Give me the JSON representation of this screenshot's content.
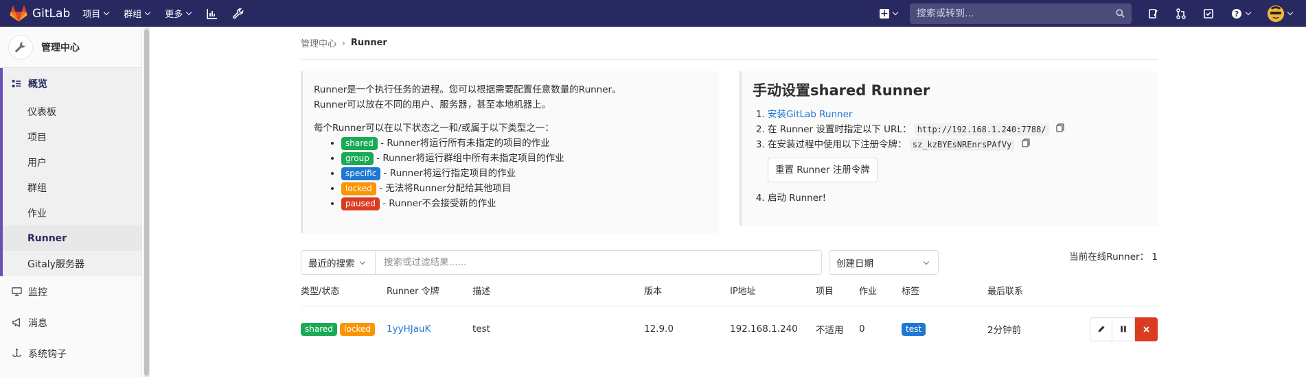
{
  "navbar": {
    "brand": "GitLab",
    "menus": [
      {
        "label": "项目"
      },
      {
        "label": "群组"
      },
      {
        "label": "更多"
      }
    ],
    "search_placeholder": "搜索或转到..."
  },
  "sidebar": {
    "title": "管理中心",
    "overview_label": "概览",
    "sub_items": [
      {
        "label": "仪表板"
      },
      {
        "label": "项目"
      },
      {
        "label": "用户"
      },
      {
        "label": "群组"
      },
      {
        "label": "作业"
      },
      {
        "label": "Runner"
      },
      {
        "label": "Gitaly服务器"
      }
    ],
    "sections": [
      {
        "label": "监控"
      },
      {
        "label": "消息"
      },
      {
        "label": "系统钩子"
      }
    ]
  },
  "breadcrumb": {
    "parent": "管理中心",
    "current": "Runner"
  },
  "info": {
    "line1": "Runner是一个执行任务的进程。您可以根据需要配置任意数量的Runner。",
    "line2": "Runner可以放在不同的用户、服务器，甚至本地机器上。",
    "states_intro": "每个Runner可以在以下状态之一和/或属于以下类型之一：",
    "states": [
      {
        "badge": "shared",
        "desc": " - Runner将运行所有未指定的项目的作业"
      },
      {
        "badge": "group",
        "desc": " - Runner将运行群组中所有未指定项目的作业"
      },
      {
        "badge": "specific",
        "desc": " - Runner将运行指定项目的作业"
      },
      {
        "badge": "locked",
        "desc": " - 无法将Runner分配给其他项目"
      },
      {
        "badge": "paused",
        "desc": " - Runner不会接受新的作业"
      }
    ]
  },
  "setup": {
    "title": "手动设置shared Runner",
    "step1_link": "安装GitLab Runner",
    "step2_text": "在 Runner 设置时指定以下 URL：",
    "url": "http://192.168.1.240:7788/",
    "step3_text": "在安装过程中使用以下注册令牌：",
    "token": "sz_kzBYEsNREnrsPAfVy",
    "reset_button": "重置 Runner 注册令牌",
    "step4_text": "启动 Runner!"
  },
  "filter": {
    "recent_label": "最近的搜索",
    "placeholder": "搜索或过滤结果......",
    "sort_label": "创建日期",
    "online_label": "当前在线Runner：",
    "online_count": "1"
  },
  "table": {
    "headers": [
      "类型/状态",
      "Runner 令牌",
      "描述",
      "版本",
      "IP地址",
      "项目",
      "作业",
      "标签",
      "最后联系"
    ],
    "rows": [
      {
        "badges": [
          "shared",
          "locked"
        ],
        "token": "1yyHJauK",
        "description": "test",
        "version": "12.9.0",
        "ip": "192.168.1.240",
        "projects": "不适用",
        "jobs": "0",
        "tag": "test",
        "last_contact": "2分钟前"
      }
    ]
  },
  "colors": {
    "navbar": "#292961",
    "accent": "#6b4fbb",
    "link": "#1f78d1",
    "success": "#1aaa55",
    "warning": "#fc9403",
    "danger": "#db3b21"
  }
}
